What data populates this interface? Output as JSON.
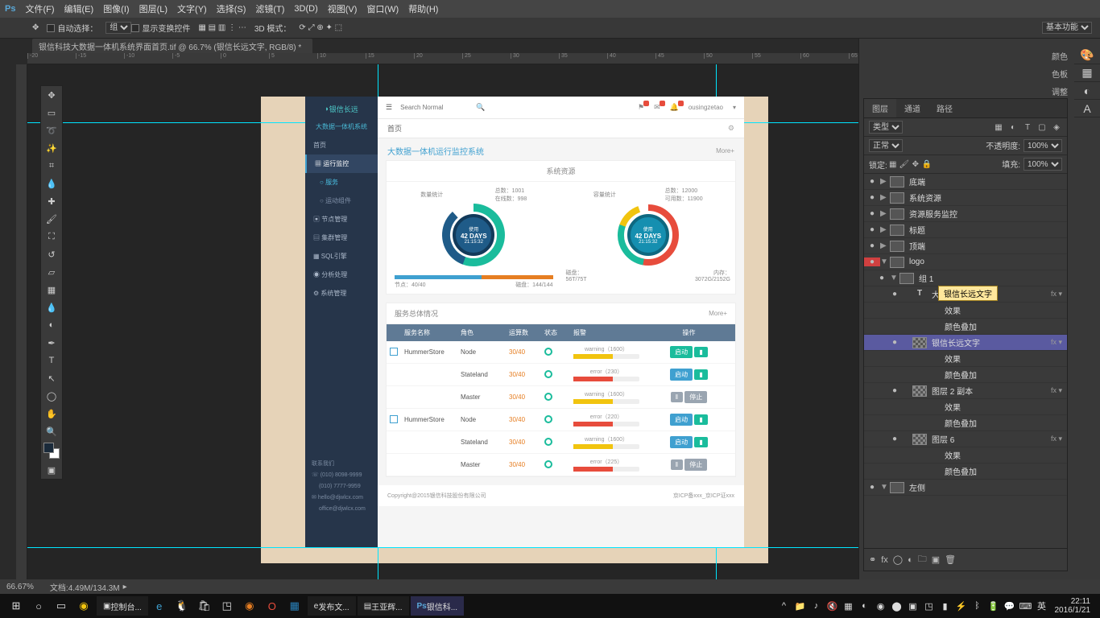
{
  "menubar": {
    "app": "Ps",
    "items": [
      "文件(F)",
      "编辑(E)",
      "图像(I)",
      "图层(L)",
      "文字(Y)",
      "选择(S)",
      "滤镜(T)",
      "3D(D)",
      "视图(V)",
      "窗口(W)",
      "帮助(H)"
    ]
  },
  "options": {
    "auto_select": "自动选择：",
    "group": "组",
    "show_transform": "显示变换控件",
    "threeD": "3D 模式：",
    "right": "基本功能"
  },
  "doc_tab": "银信科技大数据一体机系统界面首页.tif @ 66.7% (银信长远文字, RGB/8) *",
  "status": {
    "zoom": "66.67%",
    "doc": "文档:4.49M/134.3M"
  },
  "panels": {
    "right_labels": [
      "颜色",
      "色板",
      "调整",
      "样式"
    ],
    "layers_tabs": [
      "图层",
      "通道",
      "路径"
    ],
    "kind_label": "类型",
    "blend": "正常",
    "opacity_label": "不透明度:",
    "opacity": "100%",
    "lock_label": "锁定:",
    "fill_label": "填充:",
    "fill": "100%",
    "tooltip": "银信长远文字",
    "tree": [
      {
        "eye": "●",
        "ind": 0,
        "icon": "▶",
        "thumb": "grp",
        "name": "底端"
      },
      {
        "eye": "●",
        "ind": 0,
        "icon": "▶",
        "thumb": "grp",
        "name": "系统资源"
      },
      {
        "eye": "●",
        "ind": 0,
        "icon": "▶",
        "thumb": "grp",
        "name": "资源服务监控"
      },
      {
        "eye": "●",
        "ind": 0,
        "icon": "▶",
        "thumb": "grp",
        "name": "标题"
      },
      {
        "eye": "●",
        "ind": 0,
        "icon": "▶",
        "thumb": "grp",
        "name": "顶端"
      },
      {
        "eye": "●",
        "ind": 0,
        "icon": "▼",
        "thumb": "grp",
        "name": "logo",
        "cls": "logo"
      },
      {
        "eye": "●",
        "ind": 1,
        "icon": "▼",
        "thumb": "grp",
        "name": "组 1"
      },
      {
        "eye": "●",
        "ind": 2,
        "icon": "",
        "thumb": "T",
        "name": "大数据一体机...",
        "fx": "fx ▾"
      },
      {
        "eye": "",
        "ind": 3,
        "icon": "",
        "thumb": "",
        "name": "效果",
        "fx": ""
      },
      {
        "eye": "",
        "ind": 3,
        "icon": "",
        "thumb": "",
        "name": "颜色叠加",
        "fx": ""
      },
      {
        "eye": "●",
        "ind": 2,
        "icon": "",
        "thumb": "ch",
        "name": "银信长远文字",
        "fx": "fx ▾",
        "sel": true
      },
      {
        "eye": "",
        "ind": 3,
        "icon": "",
        "thumb": "",
        "name": "效果",
        "fx": ""
      },
      {
        "eye": "",
        "ind": 3,
        "icon": "",
        "thumb": "",
        "name": "颜色叠加",
        "fx": ""
      },
      {
        "eye": "●",
        "ind": 2,
        "icon": "",
        "thumb": "ch",
        "name": "图层 2 副本",
        "fx": "fx ▾"
      },
      {
        "eye": "",
        "ind": 3,
        "icon": "",
        "thumb": "",
        "name": "效果",
        "fx": ""
      },
      {
        "eye": "",
        "ind": 3,
        "icon": "",
        "thumb": "",
        "name": "颜色叠加",
        "fx": ""
      },
      {
        "eye": "●",
        "ind": 2,
        "icon": "",
        "thumb": "ch",
        "name": "图层 6",
        "fx": "fx ▾"
      },
      {
        "eye": "",
        "ind": 3,
        "icon": "",
        "thumb": "",
        "name": "效果",
        "fx": ""
      },
      {
        "eye": "",
        "ind": 3,
        "icon": "",
        "thumb": "",
        "name": "颜色叠加",
        "fx": ""
      },
      {
        "eye": "●",
        "ind": 0,
        "icon": "▼",
        "thumb": "grp",
        "name": "左侧"
      }
    ]
  },
  "mock": {
    "logo": "银信长远",
    "system": "大数据一体机系统",
    "nav": [
      "首页",
      "运行监控",
      "服务",
      "运动组件",
      "节点管理",
      "集群管理",
      "SQL引擎",
      "分析处理",
      "系统管理"
    ],
    "contact_h": "联系我们",
    "contacts": [
      "(010) 8098-9999",
      "(010) 7777-9959",
      "hello@djwlcx.com",
      "office@djwlcx.com"
    ],
    "search_ph": "Search Normal",
    "user": "ousingzetao",
    "crumb": "首页",
    "page_title": "大数据一体机运行监控系统",
    "more": "More+",
    "sec1": "系统资源",
    "left_block": {
      "title": "数量统计",
      "line1": "总数：1001",
      "line2": "在线数：998",
      "core1": "使用",
      "core2": "42 DAYS",
      "core3": "21:15:32",
      "bar1": "节点：40/40",
      "bar2": "磁盘：144/144"
    },
    "right_block": {
      "title": "容量统计",
      "line1": "总数：12000",
      "line2": "可用数：11900",
      "core1": "使用",
      "core2": "42 DAYS",
      "core3": "21:15:32",
      "s1": "磁盘：",
      "s1v": "56T/75T",
      "s2": "内存：",
      "s2v": "3072G/2152G"
    },
    "sec2": "服务总体情况",
    "thead": [
      "",
      "服务名称",
      "角色",
      "运算数",
      "状态",
      "报警",
      "操作"
    ],
    "rows": [
      {
        "g": "HummerStore",
        "role": "Node",
        "num": "30/40",
        "warn": "warning（1600）",
        "wcol": "#f1c40f",
        "b1": "启动",
        "b2": "",
        "bc": "teal"
      },
      {
        "g": "",
        "role": "Stateland",
        "num": "30/40",
        "warn": "error（230）",
        "wcol": "#e74c3c",
        "b1": "启动",
        "b2": "",
        "bc": ""
      },
      {
        "g": "",
        "role": "Master",
        "num": "30/40",
        "warn": "warning（1600）",
        "wcol": "#f1c40f",
        "b1": "‖",
        "b2": "停止",
        "bc": "grey"
      },
      {
        "g": "HummerStore",
        "role": "Node",
        "num": "30/40",
        "warn": "error（220）",
        "wcol": "#e74c3c",
        "b1": "启动",
        "b2": "",
        "bc": ""
      },
      {
        "g": "",
        "role": "Stateland",
        "num": "30/40",
        "warn": "warning（1600）",
        "wcol": "#f1c40f",
        "b1": "启动",
        "b2": "",
        "bc": ""
      },
      {
        "g": "",
        "role": "Master",
        "num": "30/40",
        "warn": "error（225）",
        "wcol": "#e74c3c",
        "b1": "‖",
        "b2": "停止",
        "bc": "grey"
      }
    ],
    "foot_l": "Copyright@2015银信科技股份有限公司",
    "foot_r": "京ICP备xxx_京ICP证xxx"
  },
  "taskbar": {
    "items": [
      "控制台...",
      "",
      "",
      "",
      "",
      "",
      "",
      "发布文...",
      "王亚辉...",
      "银信科..."
    ],
    "clock_t": "22:11",
    "clock_d": "2016/1/21",
    "ime": "英"
  }
}
